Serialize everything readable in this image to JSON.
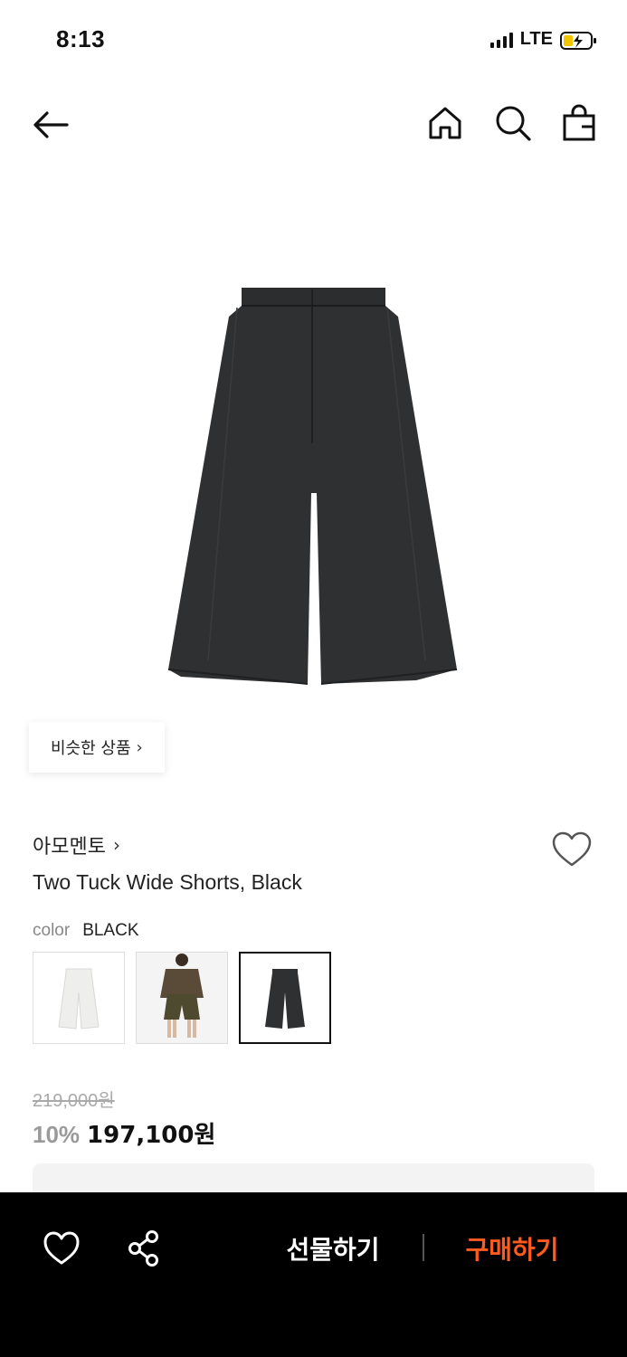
{
  "status_bar": {
    "time": "8:13",
    "network": "LTE"
  },
  "nav": {
    "icons": [
      "back-arrow-icon",
      "home-icon",
      "search-icon",
      "shopping-bag-icon"
    ]
  },
  "similar_button": {
    "label": "비슷한 상품",
    "chevron": "›"
  },
  "product": {
    "brand": "아모멘토",
    "brand_chevron": "›",
    "name": "Two Tuck Wide Shorts, Black",
    "color_label": "color",
    "color_value": "BLACK",
    "swatches": [
      {
        "name": "white-shorts",
        "selected": false
      },
      {
        "name": "khaki-shorts-model",
        "selected": false
      },
      {
        "name": "black-shorts",
        "selected": true
      }
    ],
    "original_price": "219,000원",
    "discount": "10%",
    "sale_price": "197,100원"
  },
  "bottom_bar": {
    "gift_label": "선물하기",
    "buy_label": "구매하기",
    "buy_color": "#ff5a1f"
  }
}
